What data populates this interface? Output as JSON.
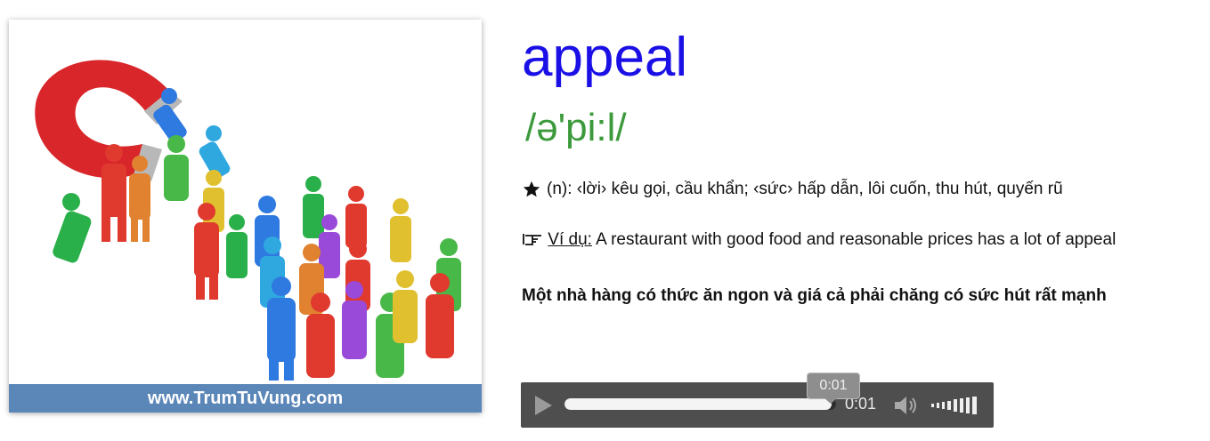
{
  "image": {
    "banner_text": "www.TrumTuVung.com",
    "illustration_icon": "magnet-attracting-people-illustration"
  },
  "entry": {
    "word": "appeal",
    "phonetic": "/ə'pi:l/",
    "definition_icon": "star-icon",
    "definition": "(n): ‹lời› kêu gọi, cầu khẩn; ‹sức› hấp dẫn, lôi cuốn, thu hút, quyến rũ",
    "example_icon": "pointing-hand-icon",
    "example_label": "Ví dụ:",
    "example_text": "A restaurant with good food and reasonable prices has a lot of appeal",
    "translation": "Một nhà hàng có thức ăn ngon và giá cả phải chăng có sức hút rất mạnh"
  },
  "audio_player": {
    "current_time": "0:01",
    "tooltip_time": "0:01",
    "progress_fraction": 0.985
  },
  "colors": {
    "word": "#1a10e6",
    "phonetic": "#3c9a3c",
    "banner": "#5a86b8",
    "player_bg": "#4e4e4e"
  }
}
